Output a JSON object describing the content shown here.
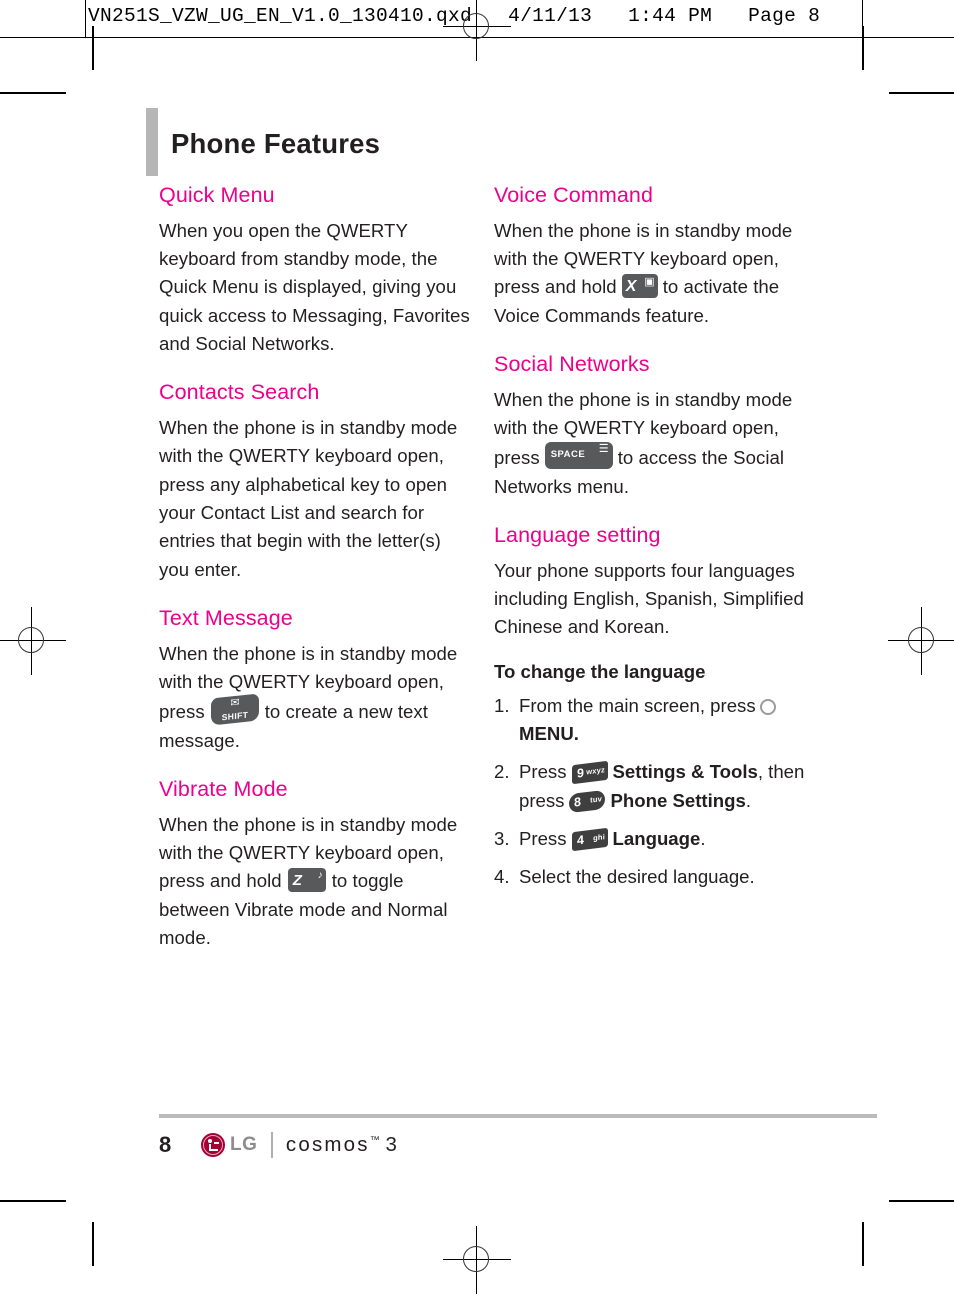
{
  "prepress": {
    "header_text": "VN251S_VZW_UG_EN_V1.0_130410.qxd   4/11/13   1:44 PM   Page 8"
  },
  "page": {
    "title": "Phone Features",
    "page_number": "8",
    "accent_color": "#ec008c",
    "title_bar_color": "#b6b6b6",
    "text_color": "#231f20"
  },
  "left_column": {
    "sections": [
      {
        "heading": "Quick Menu",
        "body": "When you open the QWERTY keyboard from standby mode, the Quick Menu is displayed, giving you quick access to Messaging, Favorites and Social Networks."
      },
      {
        "heading": "Contacts Search",
        "body": "When the phone is in standby mode with the QWERTY keyboard open, press any alphabetical key to open your Contact List and search for entries that begin with the letter(s) you enter."
      },
      {
        "heading": "Text Message",
        "body_before": "When the phone is in standby mode with the QWERTY keyboard open, press",
        "key": {
          "label": "SHIFT",
          "symbol": "✉",
          "name": "shift-key-icon"
        },
        "body_after": "to create a new text message."
      },
      {
        "heading": "Vibrate Mode",
        "body_before": "When the phone is in standby mode with the QWERTY keyboard open, press and hold",
        "key": {
          "label": "Z",
          "symbol": "♪",
          "name": "z-vibrate-key-icon"
        },
        "body_after": "to toggle between Vibrate mode and Normal mode."
      }
    ]
  },
  "right_column": {
    "sections": [
      {
        "heading": "Voice Command",
        "body_before": "When the phone is in standby mode with the QWERTY keyboard open, press and hold",
        "key": {
          "label": "X",
          "symbol": "▣",
          "name": "x-voice-key-icon"
        },
        "body_after": "to activate the Voice Commands feature."
      },
      {
        "heading": "Social Networks",
        "body_before": "When the phone is in standby mode with the QWERTY keyboard open, press",
        "key": {
          "label": "SPACE",
          "symbol": "☰",
          "name": "space-key-icon"
        },
        "body_after": "to access the Social Networks menu."
      },
      {
        "heading": "Language setting",
        "body": "Your phone supports four languages including English, Spanish, Simplified Chinese and Korean.",
        "sub_heading": "To change the language",
        "steps": [
          {
            "num": "1.",
            "text_before": "From the main screen, press",
            "key": {
              "type": "circle",
              "name": "menu-ok-button-icon"
            },
            "text_after": "",
            "bold_after": "MENU."
          },
          {
            "num": "2.",
            "text_before": "Press",
            "key": {
              "type": "num",
              "digit": "9",
              "letters": "wxyz",
              "name": "key-9-wxyz-icon"
            },
            "bold_mid": "Settings & Tools",
            "text_mid": ", then press",
            "key2": {
              "type": "num",
              "digit": "8",
              "letters": "tuv",
              "name": "key-8-tuv-icon"
            },
            "bold_end": "Phone Settings",
            "text_end": "."
          },
          {
            "num": "3.",
            "text_before": "Press",
            "key": {
              "type": "num",
              "digit": "4",
              "letters": "ghi",
              "name": "key-4-ghi-icon"
            },
            "bold_end": "Language",
            "text_end": "."
          },
          {
            "num": "4.",
            "text_before": "Select the desired language.",
            "key": null
          }
        ]
      }
    ]
  },
  "footer": {
    "page_number": "8",
    "brand": "LG",
    "product": "cosmos",
    "product_tm": "™",
    "product_version": "3"
  }
}
